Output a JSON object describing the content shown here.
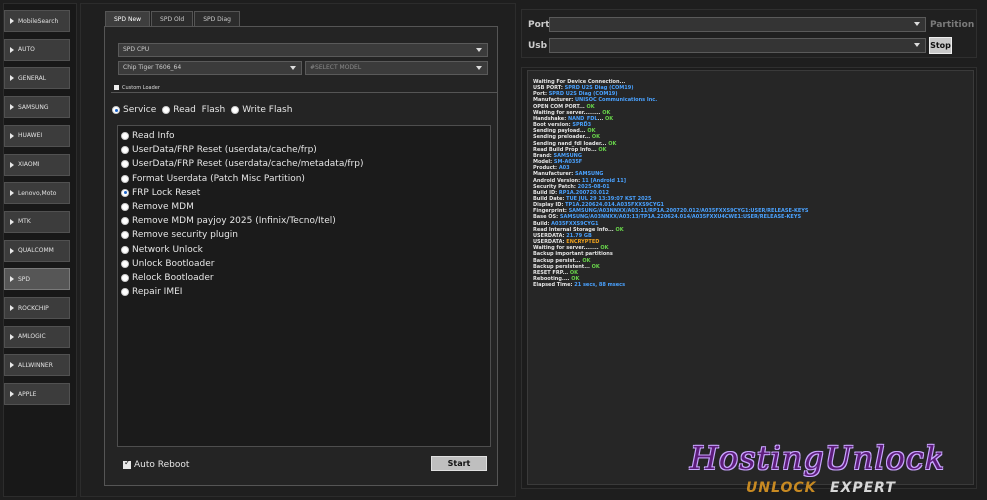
{
  "sidebar": {
    "items": [
      {
        "label": "MobileSearch"
      },
      {
        "label": "AUTO"
      },
      {
        "label": "GENERAL"
      },
      {
        "label": "SAMSUNG"
      },
      {
        "label": "HUAWEI"
      },
      {
        "label": "XIAOMI"
      },
      {
        "label": "Lenovo,Moto"
      },
      {
        "label": "MTK"
      },
      {
        "label": "QUALCOMM"
      },
      {
        "label": "SPD"
      },
      {
        "label": "ROCKCHIP"
      },
      {
        "label": "AMLOGIC"
      },
      {
        "label": "ALLWINNER"
      },
      {
        "label": "APPLE"
      }
    ],
    "active": "SPD"
  },
  "tabs": [
    {
      "label": "SPD New"
    },
    {
      "label": "SPD Old"
    },
    {
      "label": "SPD Diag"
    }
  ],
  "cpu_select": "SPD CPU",
  "chip_select": "Chip Tiger T606_64",
  "model_select": "#SELECT MODEL",
  "custom_loader": "Custom Loader",
  "modes": [
    {
      "label": "Service"
    },
    {
      "label": "Read  Flash"
    },
    {
      "label": "Write Flash"
    }
  ],
  "operations": [
    {
      "label": "Read Info"
    },
    {
      "label": "UserData/FRP Reset (userdata/cache/frp)"
    },
    {
      "label": "UserData/FRP Reset (userdata/cache/metadata/frp)"
    },
    {
      "label": "Format Userdata (Patch Misc Partition)"
    },
    {
      "label": "FRP Lock Reset"
    },
    {
      "label": "Remove MDM"
    },
    {
      "label": "Remove MDM payjoy 2025 (Infinix/Tecno/Itel)"
    },
    {
      "label": "Remove security plugin"
    },
    {
      "label": "Network Unlock"
    },
    {
      "label": "Unlock Bootloader"
    },
    {
      "label": "Relock Bootloader"
    },
    {
      "label": "Repair IMEI"
    }
  ],
  "auto_reboot": "Auto Reboot",
  "start_label": "Start",
  "port_label": "Port",
  "usb_label": "Usb",
  "partition_label": "Partition",
  "stop_label": "Stop",
  "log": [
    {
      "t": "Waiting For Device Connection..."
    },
    {
      "t": "USB PORT: ",
      "v": "SPRD U2S Diag (COM19)"
    },
    {
      "t": "Port: ",
      "v": "SPRD U2S Diag (COM19)"
    },
    {
      "t": "Manufacturer: ",
      "v": "UNISOC Communications Inc."
    },
    {
      "t": "OPEN COM PORT... ",
      "ok": "OK"
    },
    {
      "t": "Waiting for server......... ",
      "ok": "OK"
    },
    {
      "t": "Handshake: ",
      "v": "NAND_FDL",
      "t2": "... ",
      "ok": "OK"
    },
    {
      "t": "Boot version: ",
      "v": "SPRD3"
    },
    {
      "t": "Sending payload... ",
      "ok": "OK"
    },
    {
      "t": "Sending preloader... ",
      "ok": "OK"
    },
    {
      "t": "Sending nand_fdl loader... ",
      "ok": "OK"
    },
    {
      "t": "Read Build Prop Info... ",
      "ok": "OK"
    },
    {
      "t": "  Brand: ",
      "v": "SAMSUNG"
    },
    {
      "t": "  Model: ",
      "v": "SM-A035F"
    },
    {
      "t": "  Product: ",
      "v": "A03"
    },
    {
      "t": "  Manufacturer: ",
      "v": "SAMSUNG"
    },
    {
      "t": "  Android Version: ",
      "v": "11 [Android 11]"
    },
    {
      "t": "  Security Patch: ",
      "v": "2025-08-01"
    },
    {
      "t": "  Build ID: ",
      "v": "RP1A.200720.012"
    },
    {
      "t": "  Build Date: ",
      "v": "TUE JUL 29 13:39:07 KST 2025"
    },
    {
      "t": "  Display ID: ",
      "v": "TP1A.220624.014.A035FXXS9CYG1"
    },
    {
      "t": "  Fingerprint: ",
      "v": "SAMSUNG/A03NNXX/A03:11/RP1A.200720.012/A035FXXS9CYG1:USER/RELEASE-KEYS"
    },
    {
      "t": "  Base OS: ",
      "v": "SAMSUNG/A03NNXX/A03:13/TP1A.220624.014/A035FXXU4CWE1:USER/RELEASE-KEYS"
    },
    {
      "t": "  Build: ",
      "v": "A035FXXS9CYG1"
    },
    {
      "t": "Read Internal Storage Info... ",
      "ok": "OK"
    },
    {
      "t": "USERDATA: ",
      "v": "21.79 GB"
    },
    {
      "t": "USERDATA: ",
      "w": "ENCRYPTED"
    },
    {
      "t": "Waiting for server........ ",
      "ok": "OK"
    },
    {
      "t": "Backup important partitions"
    },
    {
      "t": "  Backup ",
      "b": "persist",
      "t2": "... ",
      "ok": "OK"
    },
    {
      "t": "  Backup ",
      "b": "persistent",
      "t2": "... ",
      "ok": "OK"
    },
    {
      "t": "RESET FRP... ",
      "ok": "OK"
    },
    {
      "t": "Rebooting.... ",
      "ok": "OK"
    },
    {
      "t": "Elapsed Time: ",
      "v": "21 secs, 88 msecs"
    }
  ],
  "watermark": {
    "line1": "HostingUnlock",
    "line2a": "UNLOCK",
    "line2b": "EXPERT"
  }
}
